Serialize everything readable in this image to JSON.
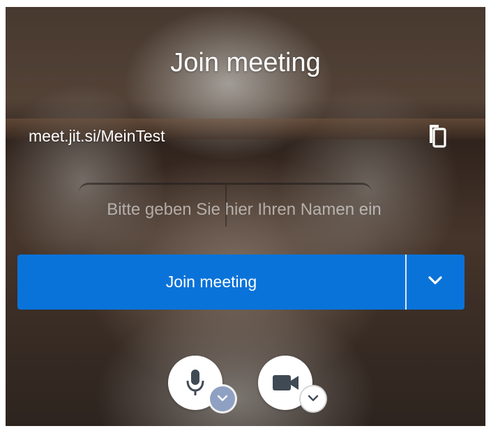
{
  "prejoin": {
    "title": "Join meeting",
    "meeting_url": "meet.jit.si/MeinTest",
    "name_input": {
      "placeholder": "Bitte geben Sie hier Ihren Namen ein",
      "value": ""
    },
    "join_button": {
      "label": "Join meeting"
    }
  },
  "icons": {
    "copy": "copy-icon",
    "dropdown": "chevron-down-icon",
    "microphone": "microphone-icon",
    "camera": "video-camera-icon"
  },
  "colors": {
    "accent": "#0a73d9",
    "mic_options_badge": "#8fa1c2",
    "text": "#ffffff"
  }
}
